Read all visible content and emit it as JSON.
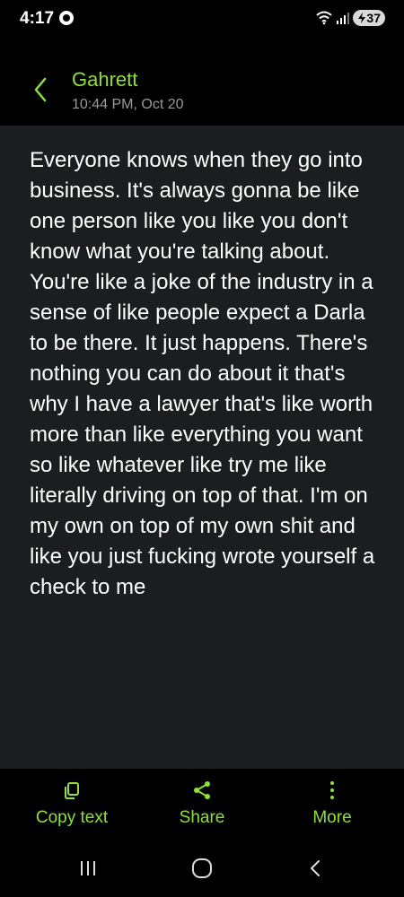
{
  "status_bar": {
    "time": "4:17",
    "battery": "37",
    "icons": [
      "messenger-icon",
      "wifi-icon",
      "signal-icon",
      "battery-icon"
    ]
  },
  "header": {
    "contact_name": "Gahrett",
    "timestamp": "10:44 PM, Oct 20"
  },
  "message": {
    "text": "Everyone knows when they go into business. It's always gonna be like one person like you like you don't know what you're talking about. You're like a joke of the industry in a sense of like people expect a Darla to be there. It just happens. There's nothing you can do about it that's why I have a lawyer that's like worth more than like everything you want so like whatever like try me like literally driving on top of that. I'm on my own on top of my own shit and like you just fucking wrote yourself a check to me"
  },
  "actions": {
    "copy_label": "Copy text",
    "share_label": "Share",
    "more_label": "More"
  },
  "colors": {
    "accent": "#8ee03b",
    "panel_bg": "#1b1d20",
    "background": "#000000"
  }
}
